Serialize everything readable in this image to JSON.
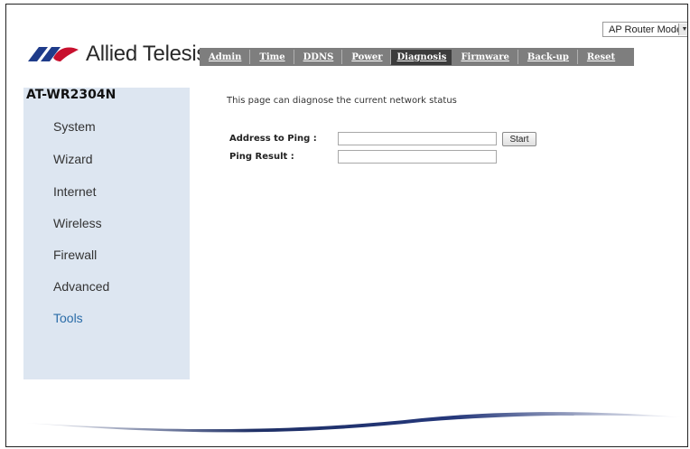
{
  "header": {
    "mode_select": {
      "value": "AP Router Mode"
    },
    "logo": {
      "brand": "Allied Telesis"
    }
  },
  "nav": {
    "tabs": [
      {
        "label": "Admin"
      },
      {
        "label": "Time"
      },
      {
        "label": "DDNS"
      },
      {
        "label": "Power"
      },
      {
        "label": "Diagnosis",
        "active": true
      },
      {
        "label": "Firmware"
      },
      {
        "label": "Back-up"
      },
      {
        "label": "Reset"
      }
    ]
  },
  "sidebar": {
    "model": "AT-WR2304N",
    "items": [
      {
        "label": "System"
      },
      {
        "label": "Wizard"
      },
      {
        "label": "Internet"
      },
      {
        "label": "Wireless"
      },
      {
        "label": "Firewall"
      },
      {
        "label": "Advanced"
      },
      {
        "label": "Tools",
        "active": true
      }
    ]
  },
  "main": {
    "description": "This page can diagnose the current network status",
    "address_label": "Address to Ping :",
    "address_value": "",
    "result_label": "Ping Result :",
    "result_value": "",
    "start_button": "Start"
  },
  "colors": {
    "nav_bg": "#7e7e7e",
    "nav_active": "#3c3c3c",
    "sidebar_bg": "#dde6f1",
    "active_link": "#2a6ca8",
    "logo_red": "#c8102e",
    "logo_blue": "#1f3c8a"
  }
}
